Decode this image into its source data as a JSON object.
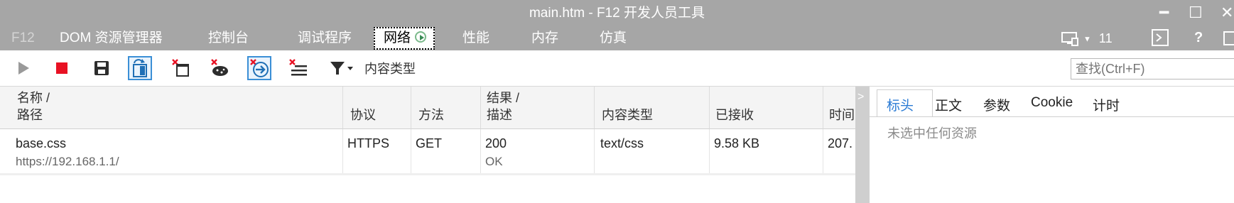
{
  "window": {
    "title": "main.htm - F12 开发人员工具",
    "controls": {
      "minimize": "━",
      "maximize": "☐",
      "close": "✕"
    }
  },
  "tabs": [
    {
      "label": "F12"
    },
    {
      "label": "DOM 资源管理器"
    },
    {
      "label": "控制台"
    },
    {
      "label": "调试程序"
    },
    {
      "label": "网络"
    },
    {
      "label": "性能"
    },
    {
      "label": "内存"
    },
    {
      "label": "仿真"
    }
  ],
  "right_tools": {
    "browser_mode": "11",
    "help": "?"
  },
  "toolbar": {
    "icons": [
      "play-icon",
      "stop-icon",
      "save-icon",
      "always-refresh-icon",
      "clear-entries-icon",
      "clear-cache-icon",
      "navigate-icon",
      "clear-list-icon",
      "filter-icon"
    ],
    "filter_label": "内容类型",
    "search_placeholder": "查找(Ctrl+F)"
  },
  "table": {
    "headers": [
      {
        "line1": "名称 /",
        "line2": "路径"
      },
      {
        "line1": "",
        "line2": "协议"
      },
      {
        "line1": "",
        "line2": "方法"
      },
      {
        "line1": "结果 /",
        "line2": "描述"
      },
      {
        "line1": "",
        "line2": "内容类型"
      },
      {
        "line1": "",
        "line2": "已接收"
      },
      {
        "line1": "",
        "line2": "时间"
      }
    ],
    "rows": [
      {
        "name": "base.css",
        "path": "https://192.168.1.1/",
        "protocol": "HTTPS",
        "method": "GET",
        "result": "200",
        "description": "OK",
        "content_type": "text/css",
        "received": "9.58 KB",
        "time": "207."
      }
    ]
  },
  "details": {
    "expander": ">",
    "tabs": [
      {
        "label": "标头"
      },
      {
        "label": "正文"
      },
      {
        "label": "参数"
      },
      {
        "label": "Cookie"
      },
      {
        "label": "计时"
      }
    ],
    "empty_text": "未选中任何资源"
  },
  "colors": {
    "title_bar": "#a6a6a6",
    "accent": "#3b8fd6",
    "stop": "#e81123"
  }
}
